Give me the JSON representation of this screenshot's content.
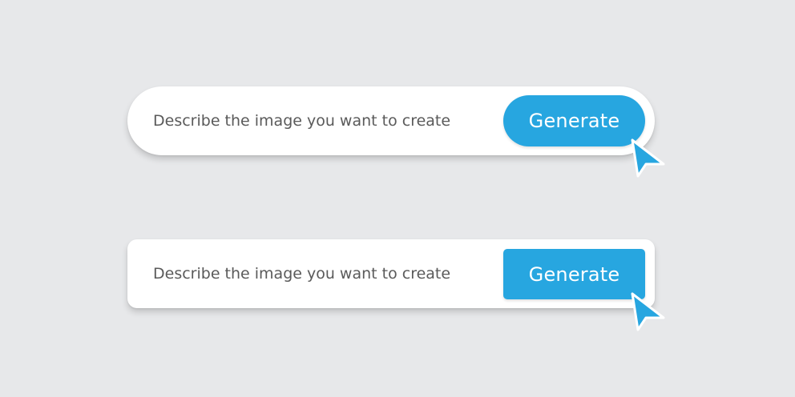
{
  "prompt_rounded": {
    "placeholder": "Describe the image you want to create",
    "button_label": "Generate"
  },
  "prompt_square": {
    "placeholder": "Describe the image you want to create",
    "button_label": "Generate"
  },
  "colors": {
    "background": "#e7e8ea",
    "bar": "#ffffff",
    "accent": "#27a6e0",
    "text": "#5a5a5a",
    "button_text": "#ffffff"
  },
  "icons": [
    "cursor-arrow-icon",
    "cursor-arrow-icon"
  ]
}
